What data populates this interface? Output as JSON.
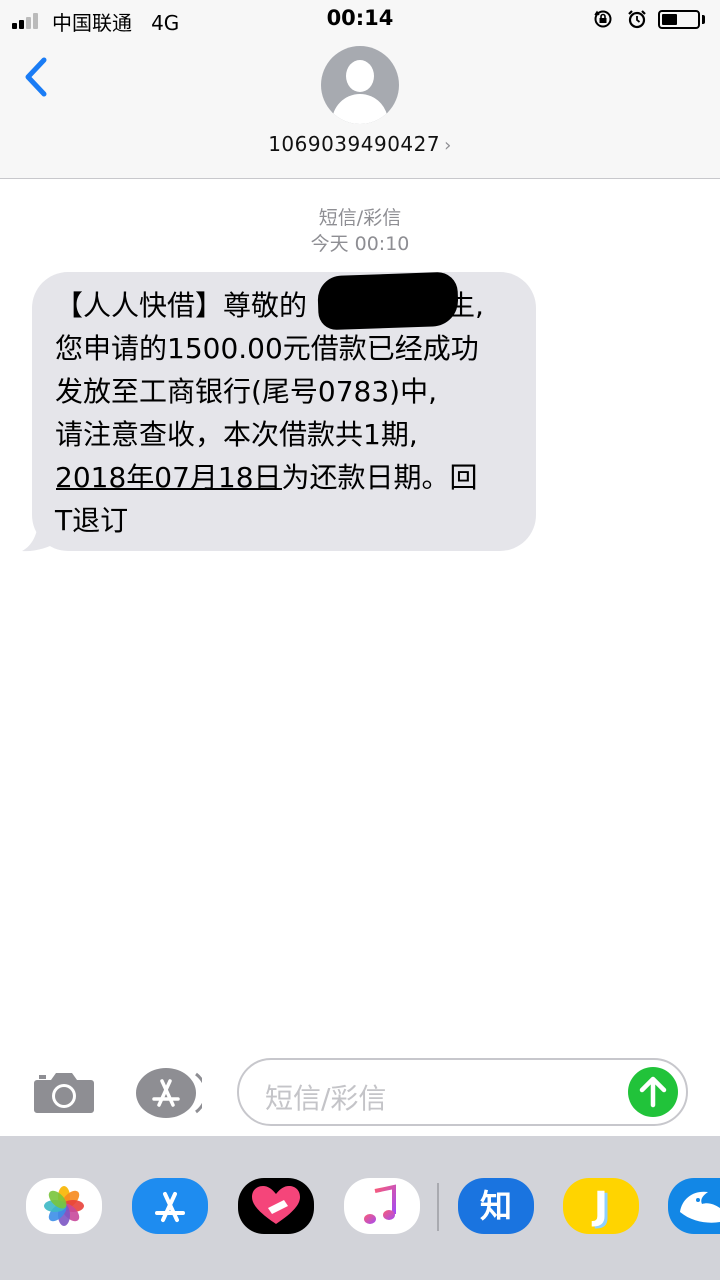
{
  "status_bar": {
    "carrier": "中国联通",
    "network": "4G",
    "time": "00:14",
    "icons": [
      "orientation-lock-icon",
      "alarm-icon"
    ],
    "battery_level": 0.45
  },
  "header": {
    "back_icon": "chevron-left-icon",
    "contact": "1069039490427",
    "contact_chevron": "›"
  },
  "thread": {
    "message_type": "短信/彩信",
    "timestamp": "今天 00:10",
    "messages": [
      {
        "direction": "incoming",
        "text": "【人人快借】尊敬的　　　　先生,\n您申请的1500.00元借款已经成功\n发放至工商银行(尾号0783)中,\n请注意查收，本次借款共1期,\n2018年07月18日为还款日期。回\nT退订"
      }
    ]
  },
  "input_bar": {
    "camera_icon": "camera-icon",
    "apps_icon": "app-store-icon",
    "placeholder": "短信/彩信",
    "send_icon": "send-arrow-icon"
  },
  "app_drawer": {
    "apps": [
      {
        "icon": "photos-icon"
      },
      {
        "icon": "app-store-icon"
      },
      {
        "icon": "heart-app-icon"
      },
      {
        "icon": "music-icon"
      },
      {
        "icon": "zhihu-icon",
        "label": "知"
      },
      {
        "icon": "j-app-icon",
        "label": "J"
      },
      {
        "icon": "bird-app-icon"
      }
    ]
  },
  "colors": {
    "accent": "#1a7cf5",
    "bubble": "#e5e5ea",
    "send": "#21c33a",
    "drawer": "#d2d3d9"
  }
}
